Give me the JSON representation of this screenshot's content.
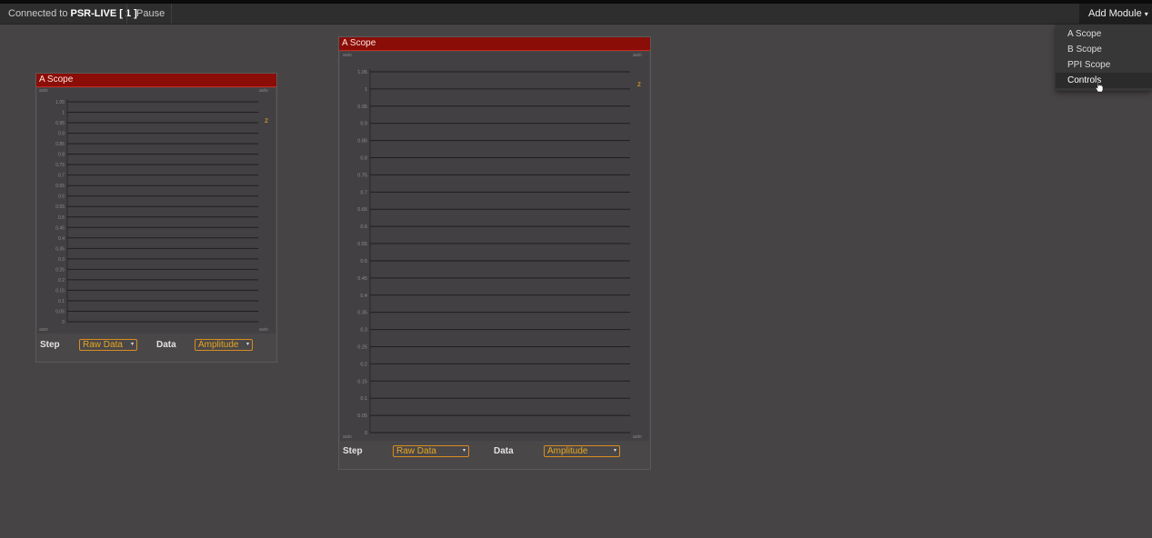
{
  "topbar": {
    "connected_prefix": "Connected to",
    "connection_name": "PSR-LIVE [ 1 ]",
    "pause_label": "Pause",
    "add_module_label": "Add Module",
    "add_module_caret": "▾"
  },
  "add_module_menu": {
    "items": [
      "A Scope",
      "B Scope",
      "PPI Scope",
      "Controls"
    ],
    "highlighted": "Controls"
  },
  "colors": {
    "title_bar": "#8a0d08",
    "accent_orange": "#e8a71e",
    "background": "#474445"
  },
  "panels": [
    {
      "title": "A Scope",
      "corner_tl": "auto",
      "corner_tr": "auto",
      "corner_bl": "auto",
      "corner_br": "auto",
      "z_label": "z",
      "step_label": "Step",
      "step_value": "Raw Data",
      "data_label": "Data",
      "data_value": "Amplitude",
      "arrow": "▾"
    },
    {
      "title": "A Scope",
      "corner_tl": "auto",
      "corner_tr": "auto",
      "corner_bl": "auto",
      "corner_br": "auto",
      "z_label": "z",
      "step_label": "Step",
      "step_value": "Raw Data",
      "data_label": "Data",
      "data_value": "Amplitude",
      "arrow": "▾"
    }
  ],
  "chart_data": [
    {
      "type": "line",
      "title": "A Scope",
      "y_ticks": [
        "1.05",
        "1",
        "0.95",
        "0.9",
        "0.85",
        "0.8",
        "0.75",
        "0.7",
        "0.65",
        "0.6",
        "0.55",
        "0.5",
        "0.45",
        "0.4",
        "0.35",
        "0.3",
        "0.25",
        "0.2",
        "0.15",
        "0.1",
        "0.05",
        "0"
      ],
      "ylim": [
        0,
        1.05
      ],
      "grid": true,
      "series": []
    },
    {
      "type": "line",
      "title": "A Scope",
      "y_ticks": [
        "1.05",
        "1",
        "0.95",
        "0.9",
        "0.85",
        "0.8",
        "0.75",
        "0.7",
        "0.65",
        "0.6",
        "0.55",
        "0.5",
        "0.45",
        "0.4",
        "0.35",
        "0.3",
        "0.25",
        "0.2",
        "0.15",
        "0.1",
        "0.05",
        "0"
      ],
      "ylim": [
        0,
        1.05
      ],
      "grid": true,
      "series": []
    }
  ]
}
